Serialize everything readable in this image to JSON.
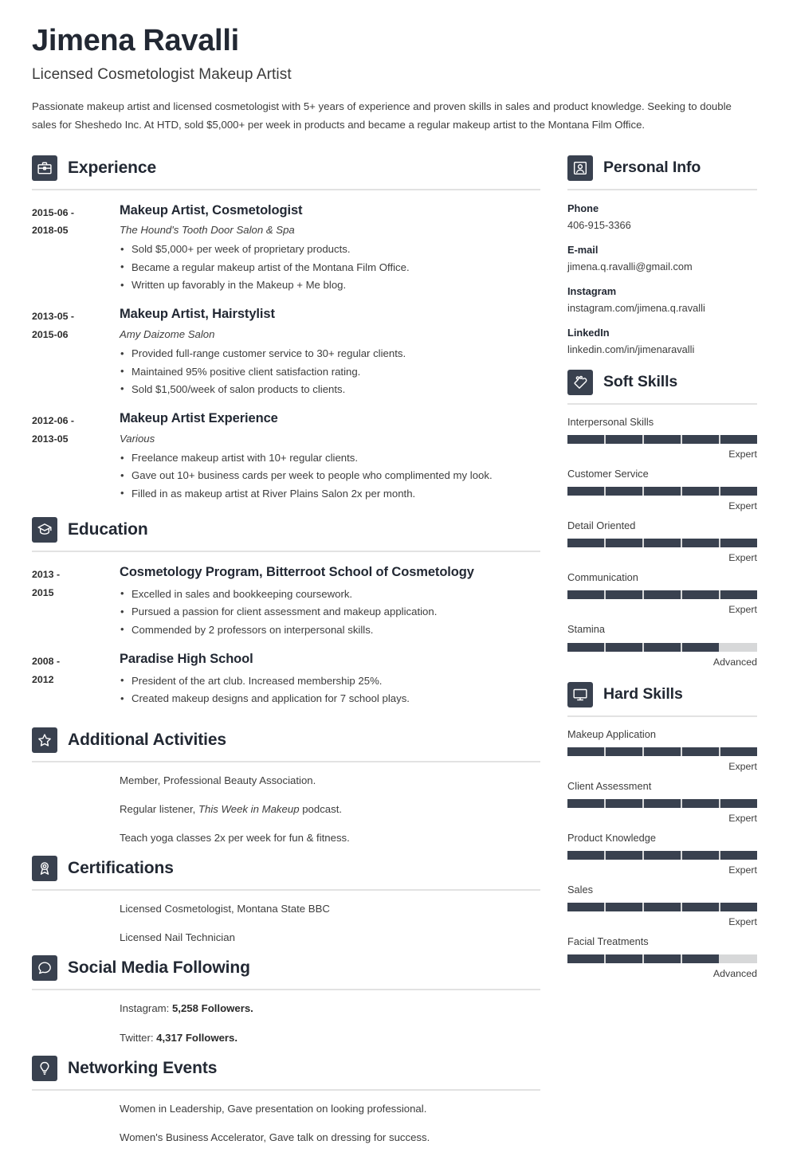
{
  "header": {
    "name": "Jimena Ravalli",
    "job_title": "Licensed Cosmetologist Makeup Artist",
    "summary": "Passionate makeup artist and licensed cosmetologist with 5+ years of experience and proven skills in sales and product knowledge. Seeking to double sales for Sheshedo Inc. At HTD, sold $5,000+ per week in products and became a regular makeup artist to the Montana Film Office."
  },
  "theme": {
    "accent_dark": "#39414f",
    "heading_color": "#222833",
    "rule_color": "#e2e2e2",
    "bar_empty": "#d7d8d9"
  },
  "experience": {
    "title": "Experience",
    "icon": "briefcase-icon",
    "entries": [
      {
        "date": "2015-06 - 2018-05",
        "role": "Makeup Artist, Cosmetologist",
        "org": "The Hound's Tooth Door Salon & Spa",
        "bullets": [
          "Sold $5,000+ per week of proprietary products.",
          "Became a regular makeup artist of the Montana Film Office.",
          "Written up favorably in the Makeup + Me blog."
        ]
      },
      {
        "date": "2013-05 - 2015-06",
        "role": "Makeup Artist, Hairstylist",
        "org": "Amy Daizome Salon",
        "bullets": [
          "Provided full-range customer service to 30+ regular clients.",
          "Maintained 95% positive client satisfaction rating.",
          "Sold $1,500/week of salon products to clients."
        ]
      },
      {
        "date": "2012-06 - 2013-05",
        "role": "Makeup Artist Experience",
        "org": "Various",
        "bullets": [
          "Freelance makeup artist with 10+ regular clients.",
          "Gave out 10+ business cards per week to people who complimented my look.",
          "Filled in as makeup artist at River Plains Salon 2x per month."
        ]
      }
    ]
  },
  "education": {
    "title": "Education",
    "icon": "graduation-cap-icon",
    "entries": [
      {
        "date": "2013 - 2015",
        "role": "Cosmetology Program, Bitterroot School of Cosmetology",
        "org": "",
        "bullets": [
          "Excelled in sales and bookkeeping coursework.",
          "Pursued a passion for client assessment and makeup application.",
          "Commended by 2 professors on interpersonal skills."
        ]
      },
      {
        "date": "2008 - 2012",
        "role": "Paradise High School",
        "org": "",
        "bullets": [
          "President of the art club. Increased membership 25%.",
          "Created makeup designs and application for 7 school plays."
        ]
      }
    ]
  },
  "additional_activities": {
    "title": "Additional Activities",
    "icon": "star-icon",
    "items": [
      {
        "prefix": "Member, Professional Beauty Association.",
        "italic": "",
        "suffix": ""
      },
      {
        "prefix": "Regular listener, ",
        "italic": "This Week in Makeup",
        "suffix": " podcast."
      },
      {
        "prefix": "Teach yoga classes 2x per week for fun & fitness.",
        "italic": "",
        "suffix": ""
      }
    ]
  },
  "certifications": {
    "title": "Certifications",
    "icon": "award-ribbon-icon",
    "items": [
      {
        "prefix": "Licensed Cosmetologist, Montana State BBC",
        "italic": "",
        "suffix": ""
      },
      {
        "prefix": "Licensed Nail Technician",
        "italic": "",
        "suffix": ""
      }
    ]
  },
  "social_media": {
    "title": "Social Media Following",
    "icon": "speech-bubble-icon",
    "items": [
      {
        "prefix": "Instagram: ",
        "bold": "5,258 Followers.",
        "suffix": ""
      },
      {
        "prefix": "Twitter: ",
        "bold": "4,317 Followers.",
        "suffix": ""
      }
    ]
  },
  "networking_events": {
    "title": "Networking Events",
    "icon": "lightbulb-icon",
    "items": [
      {
        "prefix": "Women in Leadership, Gave presentation on looking professional.",
        "italic": "",
        "suffix": ""
      },
      {
        "prefix": "Women's Business Accelerator, Gave talk on dressing for success.",
        "italic": "",
        "suffix": ""
      }
    ]
  },
  "personal_info": {
    "title": "Personal Info",
    "icon": "person-icon",
    "items": [
      {
        "label": "Phone",
        "value": "406-915-3366"
      },
      {
        "label": "E-mail",
        "value": "jimena.q.ravalli@gmail.com"
      },
      {
        "label": "Instagram",
        "value": "instagram.com/jimena.q.ravalli"
      },
      {
        "label": "LinkedIn",
        "value": "linkedin.com/in/jimenaravalli"
      }
    ]
  },
  "soft_skills": {
    "title": "Soft Skills",
    "icon": "hand-heart-icon",
    "segments": 5,
    "items": [
      {
        "name": "Interpersonal Skills",
        "level": "Expert",
        "filled": 5
      },
      {
        "name": "Customer Service",
        "level": "Expert",
        "filled": 5
      },
      {
        "name": "Detail Oriented",
        "level": "Expert",
        "filled": 5
      },
      {
        "name": "Communication",
        "level": "Expert",
        "filled": 5
      },
      {
        "name": "Stamina",
        "level": "Advanced",
        "filled": 4
      }
    ]
  },
  "hard_skills": {
    "title": "Hard Skills",
    "icon": "monitor-icon",
    "segments": 5,
    "items": [
      {
        "name": "Makeup Application",
        "level": "Expert",
        "filled": 5
      },
      {
        "name": "Client Assessment",
        "level": "Expert",
        "filled": 5
      },
      {
        "name": "Product Knowledge",
        "level": "Expert",
        "filled": 5
      },
      {
        "name": "Sales",
        "level": "Expert",
        "filled": 5
      },
      {
        "name": "Facial Treatments",
        "level": "Advanced",
        "filled": 4
      }
    ]
  }
}
